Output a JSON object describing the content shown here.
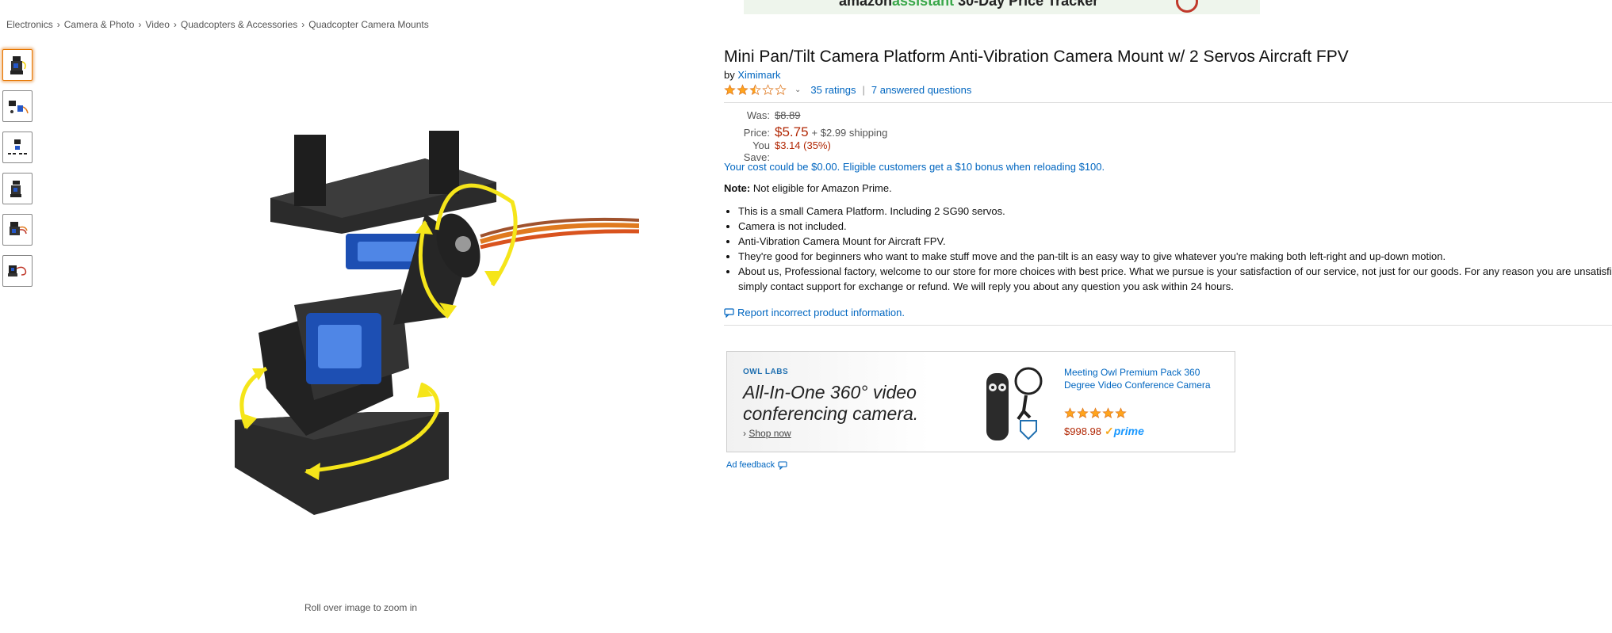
{
  "breadcrumb": [
    "Electronics",
    "Camera & Photo",
    "Video",
    "Quadcopters & Accessories",
    "Quadcopter Camera Mounts"
  ],
  "breadcrumb_separator": "›",
  "banner": {
    "text_a": "amazon",
    "text_b": "assistant",
    "text_c": "30-Day Price Tracker"
  },
  "zoom_hint": "Roll over image to zoom in",
  "product": {
    "title": "Mini Pan/Tilt Camera Platform Anti-Vibration Camera Mount w/ 2 Servos Aircraft FPV",
    "by_label": "by",
    "brand": "Ximimark",
    "rating_value": 2.5,
    "ratings_text": "35 ratings",
    "separator": "|",
    "questions_text": "7 answered questions"
  },
  "pricing": {
    "was_label": "Was:",
    "was_value": "$8.89",
    "price_label": "Price:",
    "price_value": "$5.75",
    "shipping": "+ $2.99 shipping",
    "save_label": "You Save:",
    "save_value": "$3.14 (35%)"
  },
  "promo": "Your cost could be $0.00. Eligible customers get a $10 bonus when reloading $100.",
  "note": {
    "label": "Note:",
    "text": " Not eligible for Amazon Prime."
  },
  "bullets": [
    "This is a small Camera Platform. Including 2 SG90 servos.",
    "Camera is not included.",
    "Anti-Vibration Camera Mount for Aircraft FPV.",
    "They're good for beginners who want to make stuff move and the pan-tilt is an easy way to give whatever you're making both left-right and up-down motion.",
    "About us, Professional factory, welcome to our store for more choices with best price. What we pursue is your satisfaction of our service, not just for our goods. For any reason you are unsatisfied,",
    "simply contact support for exchange or refund. We will reply you about any question you ask within 24 hours."
  ],
  "report_link": "Report incorrect product information.",
  "ad": {
    "brand": "OWL LABS",
    "headline_1": "All-In-One 360° video",
    "headline_2": "conferencing camera.",
    "shop": "Shop now",
    "product_name": "Meeting Owl Premium Pack 360 Degree Video Conference Camera",
    "rating_value": 5,
    "price": "$998.98",
    "prime": "prime"
  },
  "ad_feedback": "Ad feedback",
  "colors": {
    "link": "#0066c0",
    "price": "#b12704",
    "star": "#ffa41c",
    "thumb_active": "#e77600"
  }
}
